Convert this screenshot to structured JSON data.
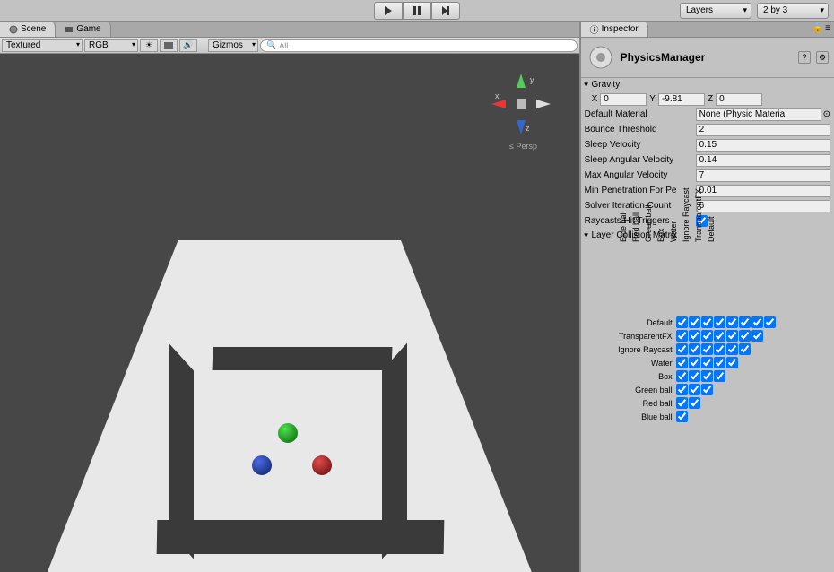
{
  "top": {
    "layers": "Layers",
    "layout": "2 by 3"
  },
  "tabs": {
    "scene": "Scene",
    "game": "Game",
    "inspector": "Inspector"
  },
  "sceneBar": {
    "shading": "Textured",
    "render": "RGB",
    "gizmos": "Gizmos",
    "searchPlaceholder": "All"
  },
  "gizmo": {
    "x": "x",
    "y": "y",
    "z": "z",
    "persp": "Persp"
  },
  "inspector": {
    "title": "PhysicsManager",
    "gravity": {
      "label": "Gravity",
      "x": "0",
      "y": "-9.81",
      "z": "0"
    },
    "defaultMaterial": {
      "label": "Default Material",
      "value": "None (Physic Materia"
    },
    "bounceThreshold": {
      "label": "Bounce Threshold",
      "value": "2"
    },
    "sleepVelocity": {
      "label": "Sleep Velocity",
      "value": "0.15"
    },
    "sleepAngularVelocity": {
      "label": "Sleep Angular Velocity",
      "value": "0.14"
    },
    "maxAngularVelocity": {
      "label": "Max Angular Velocity",
      "value": "7"
    },
    "minPenetration": {
      "label": "Min Penetration For Pe",
      "value": "0.01"
    },
    "solverIteration": {
      "label": "Solver Iteration Count",
      "value": "6"
    },
    "raycastsHit": {
      "label": "Raycasts Hit Triggers"
    },
    "matrixLabel": "Layer Collision Matrix",
    "layers": [
      "Default",
      "TransparentFX",
      "Ignore Raycast",
      "Water",
      "Box",
      "Green ball",
      "Red ball",
      "Blue ball"
    ]
  }
}
